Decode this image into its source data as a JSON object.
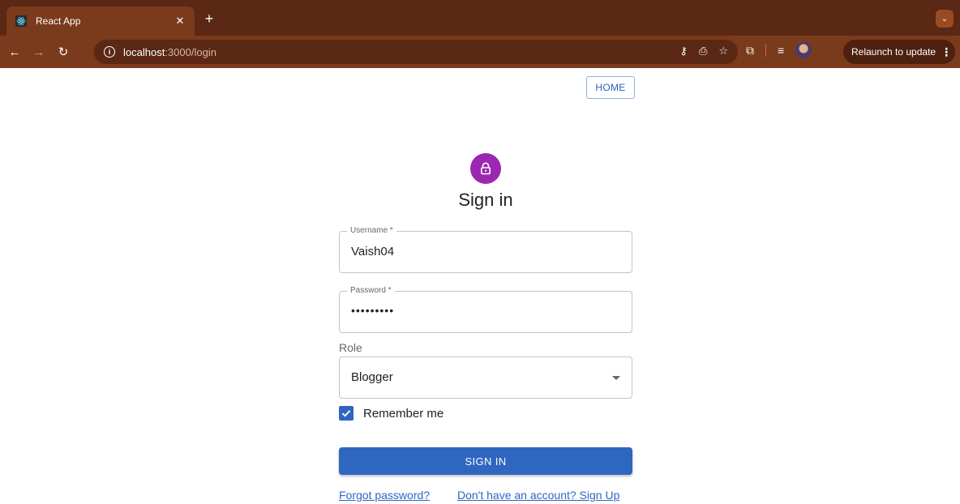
{
  "browser": {
    "tab_title": "React App",
    "tab_close": "✕",
    "new_tab": "+",
    "tab_menu": "⌄",
    "url_host": "localhost",
    "url_path": ":3000/login",
    "relaunch_label": "Relaunch to update",
    "relaunch_menu": "⋮"
  },
  "nav": {
    "home_label": "HOME"
  },
  "form": {
    "title": "Sign in",
    "username": {
      "label": "Username *",
      "value": "Vaish04"
    },
    "password": {
      "label": "Password *",
      "value": "•••••••••"
    },
    "role": {
      "label": "Role",
      "value": "Blogger"
    },
    "remember_label": "Remember me",
    "remember_checked": true,
    "submit_label": "SIGN IN",
    "forgot_link": "Forgot password?",
    "signup_link": "Don't have an account? Sign Up"
  },
  "colors": {
    "primary": "#2f66c0",
    "avatar": "#9c27b0",
    "chrome_dark": "#5a2814",
    "chrome_mid": "#7a3a1c"
  }
}
